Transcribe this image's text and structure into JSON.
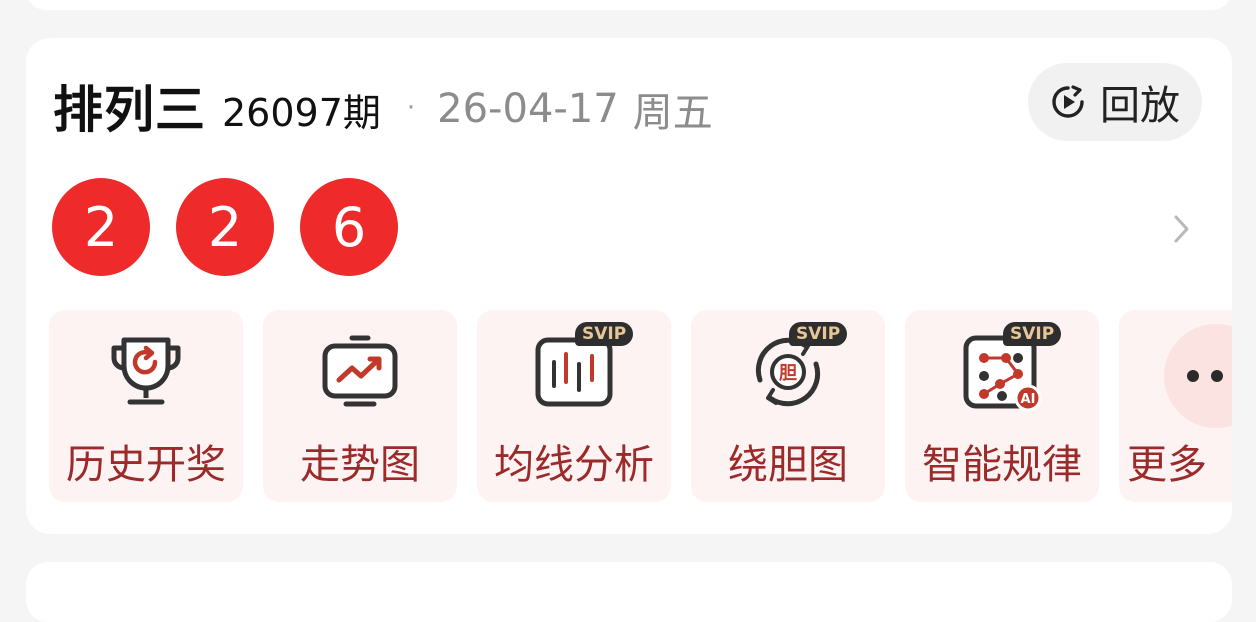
{
  "header": {
    "lottery_name": "排列三",
    "issue": "26097期",
    "separator": "·",
    "date": "26-04-17",
    "weekday": "周五",
    "replay_label": "回放"
  },
  "draw": {
    "numbers": [
      "2",
      "2",
      "6"
    ],
    "ball_color": "#ee2a2a"
  },
  "tools": [
    {
      "label": "历史开奖",
      "icon": "trophy-refresh-icon",
      "badge": ""
    },
    {
      "label": "走势图",
      "icon": "trend-monitor-icon",
      "badge": ""
    },
    {
      "label": "均线分析",
      "icon": "candlestick-chart-icon",
      "badge": "SVIP"
    },
    {
      "label": "绕胆图",
      "icon": "circle-arrows-icon",
      "badge": "SVIP",
      "icon_text": "胆"
    },
    {
      "label": "智能规律",
      "icon": "dice-network-icon",
      "badge": "SVIP",
      "icon_text": "AI"
    },
    {
      "label": "更多",
      "icon": "more-dots-icon",
      "badge": ""
    }
  ],
  "colors": {
    "accent_red": "#ee2a2a",
    "tool_bg": "#fdf3f2",
    "tool_text": "#9b2a2a",
    "svip_bg": "#2e2e2e",
    "svip_text": "#e6c79b"
  }
}
